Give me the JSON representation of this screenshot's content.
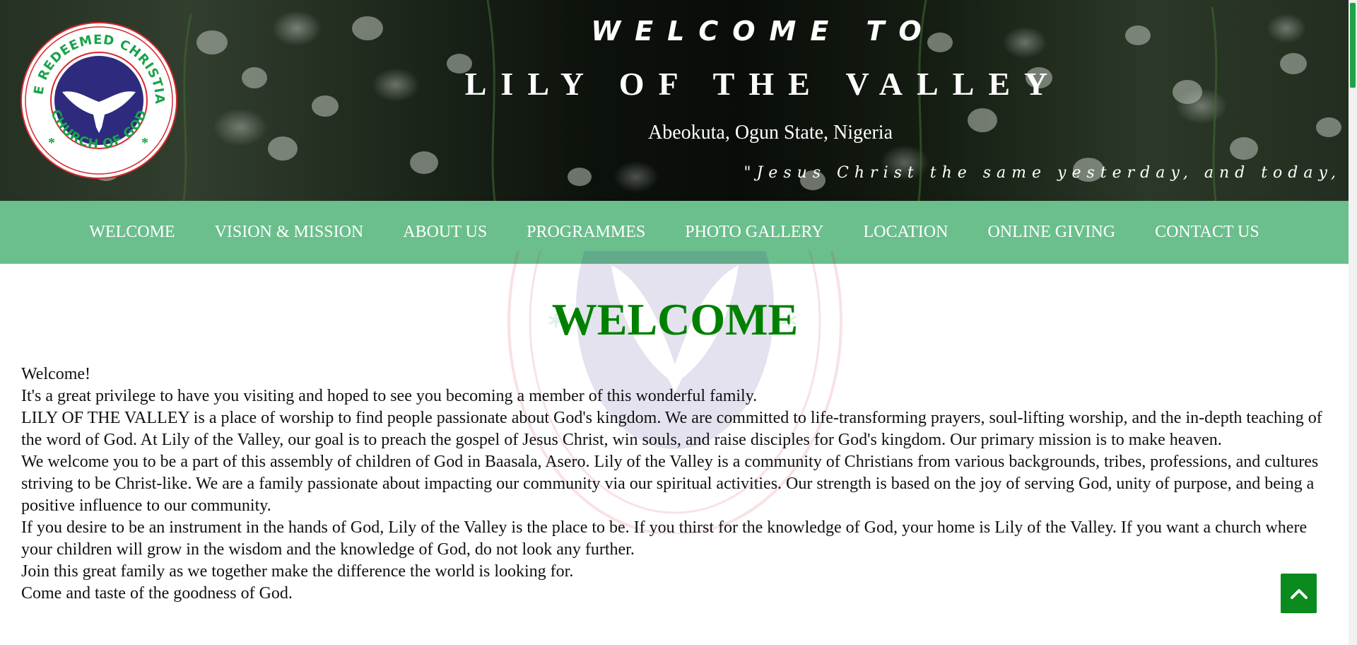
{
  "header": {
    "logo_text_top": "THE REDEEMED CHRISTIAN",
    "logo_text_bottom": "CHURCH OF GOD",
    "welcome_to": "WELCOME TO",
    "church_name": "LILY OF THE VALLEY",
    "location": "Abeokuta, Ogun State, Nigeria",
    "scripture_marquee": "\"Jesus Christ the same yesterday, and today,"
  },
  "nav": {
    "items": [
      {
        "label": "WELCOME"
      },
      {
        "label": "VISION & MISSION"
      },
      {
        "label": "ABOUT US"
      },
      {
        "label": "PROGRAMMES"
      },
      {
        "label": "PHOTO GALLERY"
      },
      {
        "label": "LOCATION"
      },
      {
        "label": "ONLINE GIVING"
      },
      {
        "label": "CONTACT US"
      }
    ]
  },
  "main": {
    "title": "WELCOME",
    "paragraphs": [
      "Welcome!",
      "It's a great privilege to have you visiting and hoped to see you becoming a member of this wonderful family.",
      "LILY OF THE VALLEY is a place of worship to find people passionate about God's kingdom. We are committed to life-transforming prayers, soul-lifting worship, and the in-depth teaching of the word of God. At Lily of the Valley, our goal is to preach the gospel of Jesus Christ, win souls, and raise disciples for God's kingdom. Our primary mission is to make heaven.",
      "We welcome you to be a part of this assembly of children of God in Baasala, Asero. Lily of the Valley is a community of Christians from various backgrounds, tribes, professions, and cultures striving to be Christ-like. We are a family passionate about impacting our community via our spiritual activities. Our strength is based on the joy of serving God, unity of purpose, and being a positive influence to our community.",
      "If you desire to be an instrument in the hands of God, Lily of the Valley is the place to be. If you thirst for the knowledge of God, your home is Lily of the Valley. If you want a church where your children will grow in the wisdom and the knowledge of God, do not look any further.",
      "Join this great family as we together make the difference the world is looking for.",
      "Come and taste of the goodness of God."
    ]
  },
  "icons": {
    "back_to_top": "chevron-up-icon"
  },
  "colors": {
    "nav_background": "#6abf8c",
    "title_green": "#008000",
    "back_to_top_green": "#0b8a1d",
    "logo_blue": "#2e2b7f",
    "logo_green": "#1aa34a",
    "logo_red": "#d8282f"
  }
}
